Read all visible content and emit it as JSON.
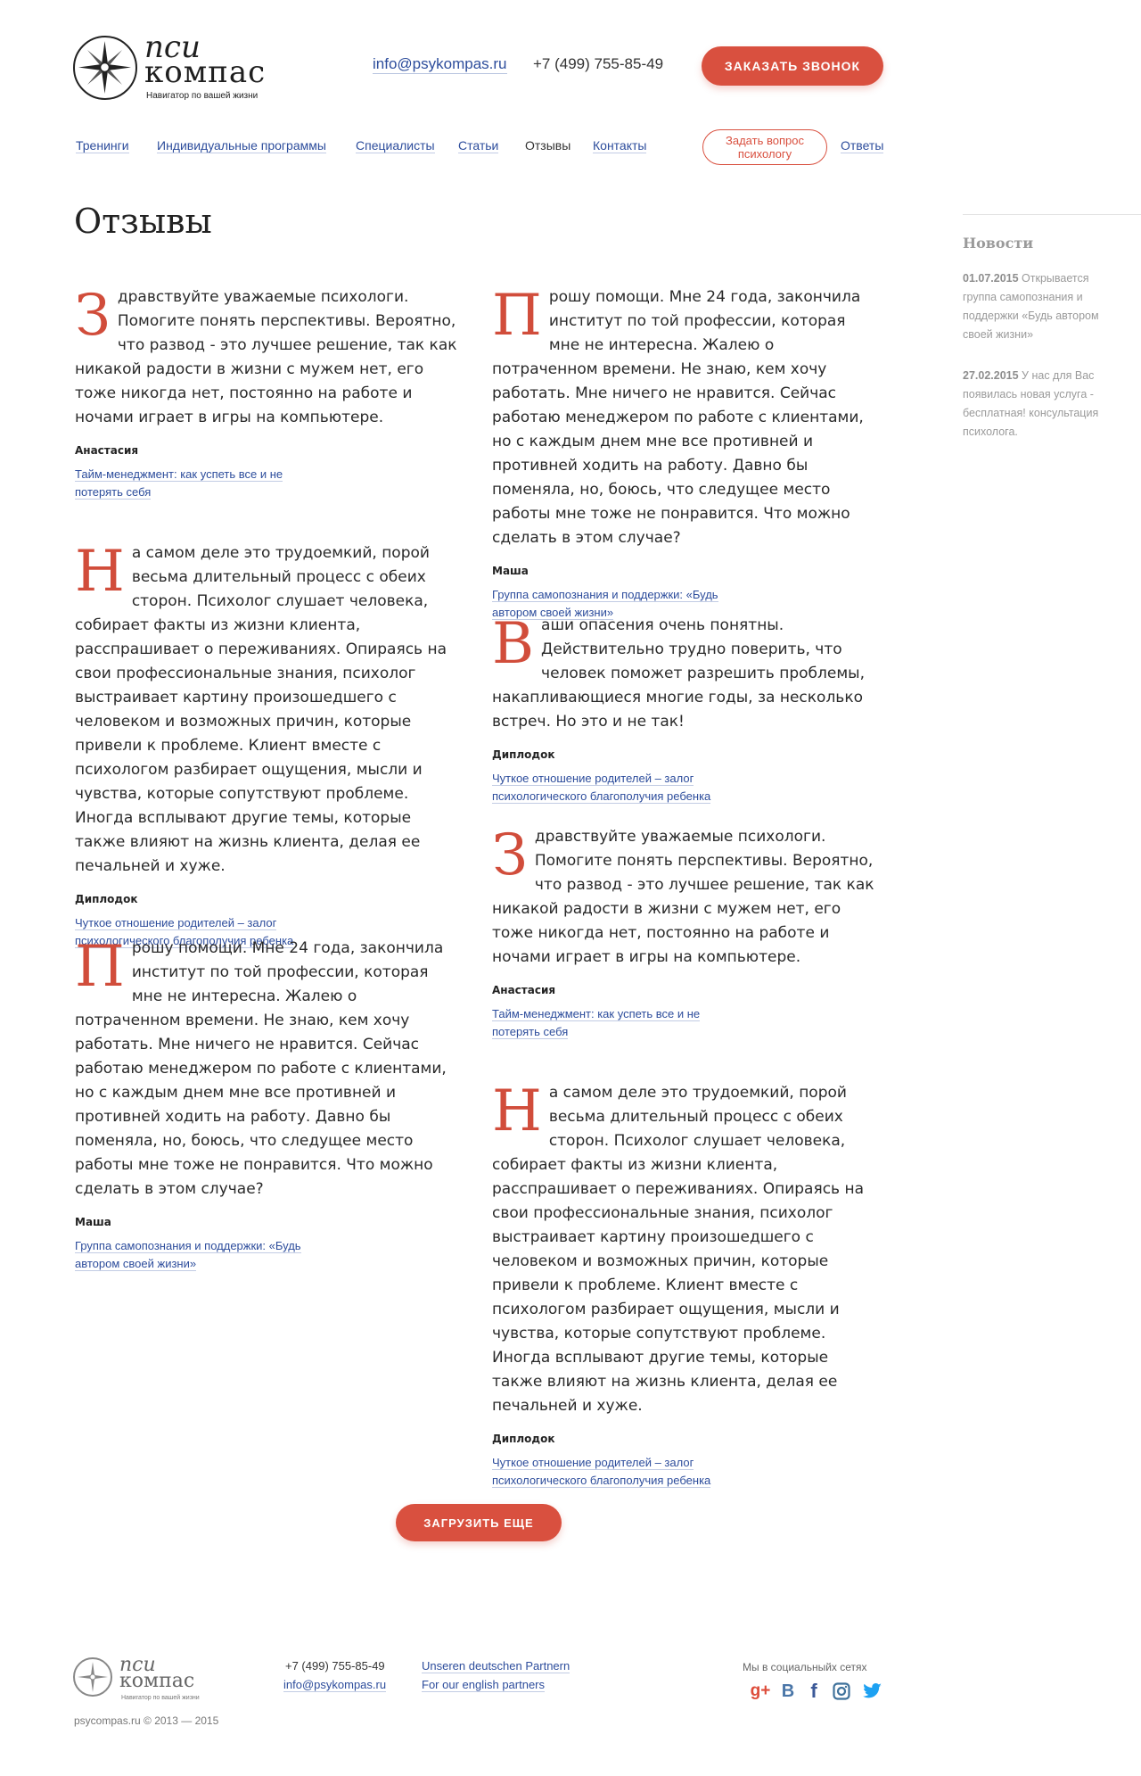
{
  "header": {
    "logo_top": "пси",
    "logo_bottom": "компас",
    "logo_tagline": "Навигатор по вашей жизни",
    "email": "info@psykompas.ru",
    "phone": "+7 (499) 755-85-49",
    "call_button": "ЗАКАЗАТЬ ЗВОНОК"
  },
  "nav": {
    "items": [
      "Тренинги",
      "Индивидуальные программы",
      "Специалисты",
      "Статьи",
      "Отзывы",
      "Контакты"
    ],
    "active": "Отзывы",
    "ask_button": "Задать вопрос психологу",
    "answers": "Ответы"
  },
  "page_title": "Отзывы",
  "reviews_left": [
    {
      "initial": "З",
      "text": "дравствуйте уважаемые психологи. Помогите понять перспективы. Вероятно, что развод - это лучшее решение, так как никакой радости в жизни с мужем нет, его тоже никогда нет, постоянно на работе и ночами играет в игры на компьютере.",
      "author": "Анастасия",
      "link": "Тайм-менеджмент: как успеть все и не потерять себя"
    },
    {
      "initial": "Н",
      "text": "а самом деле это трудоемкий, порой весьма длительный процесс с обеих сторон. Психолог слушает человека, собирает факты из жизни клиента, расспрашивает о переживаниях. Опираясь на свои профессиональные знания, психолог выстраивает картину произошедшего с человеком и возможных причин, которые привели к проблеме. Клиент вместе с психологом разбирает ощущения, мысли и чувства, которые сопутствуют проблеме. Иногда всплывают другие темы, которые также влияют на жизнь клиента, делая ее печальней и хуже.",
      "author": "Диплодок",
      "link": "Чуткое отношение родителей – залог психологического благополучия ребенка"
    },
    {
      "initial": "П",
      "text": "рошу помощи. Мне 24 года, закончила институт по той профессии, которая мне не интересна. Жалею о потраченном времени. Не знаю, кем хочу работать. Мне ничего не нравится. Сейчас работаю менеджером по работе с клиентами, но с каждым днем мне все противней и противней ходить на работу. Давно бы поменяла, но, боюсь, что следущее место работы мне тоже не понравится. Что можно сделать в этом случае?",
      "author": "Маша",
      "link": "Группа самопознания и поддержки: «Будь автором своей жизни»"
    }
  ],
  "reviews_right": [
    {
      "initial": "П",
      "text": "рошу помощи. Мне 24 года, закончила институт по той профессии, которая мне не интересна. Жалею о потраченном времени. Не знаю, кем хочу работать. Мне ничего не нравится. Сейчас работаю менеджером по работе с клиентами, но с каждым днем мне все противней и противней ходить на работу. Давно бы поменяла, но, боюсь, что следущее место работы мне тоже не понравится. Что можно сделать в этом случае?",
      "author": "Маша",
      "link": "Группа самопознания и поддержки: «Будь автором своей жизни»"
    },
    {
      "initial": "В",
      "text": "аши опасения очень понятны. Действительно трудно поверить, что человек поможет разрешить проблемы, накапливающиеся многие годы, за несколько встреч. Но это и не так!",
      "author": "Диплодок",
      "link": "Чуткое отношение родителей – залог психологического благополучия ребенка"
    },
    {
      "initial": "З",
      "text": "дравствуйте уважаемые психологи. Помогите понять перспективы. Вероятно, что развод - это лучшее решение, так как никакой радости в жизни с мужем нет, его тоже никогда нет, постоянно на работе и ночами играет в игры на компьютере.",
      "author": "Анастасия",
      "link": "Тайм-менеджмент: как успеть все и не потерять себя"
    },
    {
      "initial": "Н",
      "text": "а самом деле это трудоемкий, порой весьма длительный процесс с обеих сторон. Психолог слушает человека, собирает факты из жизни клиента, расспрашивает о переживаниях. Опираясь на свои профессиональные знания, психолог выстраивает картину произошедшего с человеком и возможных причин, которые привели к проблеме. Клиент вместе с психологом разбирает ощущения, мысли и чувства, которые сопутствуют проблеме. Иногда всплывают другие темы, которые также влияют на жизнь клиента, делая ее печальней и хуже.",
      "author": "Диплодок",
      "link": "Чуткое отношение родителей – залог психологического благополучия ребенка"
    }
  ],
  "load_more": "ЗАГРУЗИТЬ ЕЩЕ",
  "sidebar": {
    "title": "Новости",
    "news": [
      {
        "date": "01.07.2015",
        "text": "Открывается группа самопознания и поддержки «Будь автором своей жизни»"
      },
      {
        "date": "27.02.2015",
        "text": "У нас для Вас появилась новая услуга - бесплатная! консультация психолога."
      }
    ]
  },
  "footer": {
    "logo_top": "пси",
    "logo_bottom": "компас",
    "logo_tagline": "Навигатор по вашей жизни",
    "copyright": "psycompas.ru © 2013 — 2015",
    "phone": "+7 (499) 755-85-49",
    "email": "info@psykompas.ru",
    "partners_de": "Unseren deutschen Partnern",
    "partners_en": "For our english partners",
    "social_label": "Мы в социальныйх сетях",
    "social": [
      {
        "icon": "google-plus-icon",
        "glyph": "g+",
        "color": "#dd4b39"
      },
      {
        "icon": "vk-icon",
        "glyph": "В",
        "color": "#4a76a8"
      },
      {
        "icon": "facebook-icon",
        "glyph": "f",
        "color": "#3b5998"
      },
      {
        "icon": "instagram-icon",
        "glyph": "◎",
        "color": "#3f729b"
      },
      {
        "icon": "twitter-icon",
        "glyph": "🐦",
        "color": "#1da1f2"
      }
    ]
  }
}
